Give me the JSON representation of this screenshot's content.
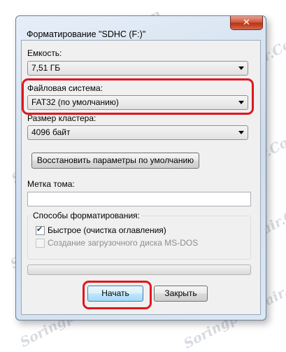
{
  "watermark": "Soringpcrepair.Com",
  "window": {
    "title": "Форматирование \"SDHC (F:)\"",
    "close_glyph": "✕"
  },
  "capacity": {
    "label": "Емкость:",
    "value": "7,51 ГБ"
  },
  "filesystem": {
    "label": "Файловая система:",
    "value": "FAT32 (по умолчанию)"
  },
  "cluster": {
    "label": "Размер кластера:",
    "value": "4096 байт"
  },
  "restore_button": "Восстановить параметры по умолчанию",
  "volume": {
    "label": "Метка тома:",
    "value": ""
  },
  "format_options": {
    "label": "Способы форматирования:",
    "quick": {
      "label": "Быстрое (очистка оглавления)",
      "checked": true
    },
    "msdos": {
      "label": "Создание загрузочного диска MS-DOS",
      "checked": false,
      "enabled": false
    }
  },
  "progress": {
    "value_percent": 0
  },
  "buttons": {
    "start": "Начать",
    "close": "Закрыть"
  },
  "colors": {
    "highlight": "#e0161e",
    "close_button": "#c7462a"
  }
}
